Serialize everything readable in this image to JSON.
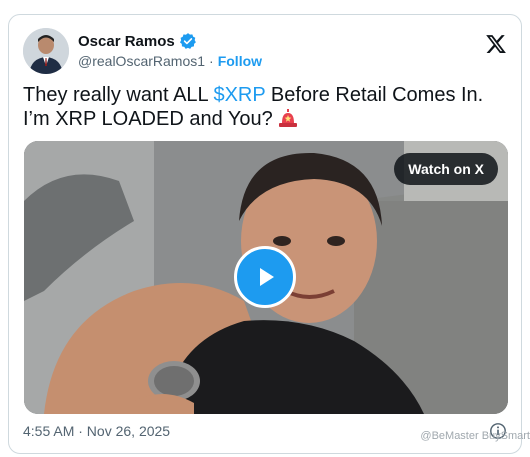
{
  "author": {
    "display_name": "Oscar Ramos",
    "handle": "@realOscarRamos1",
    "separator": "·",
    "follow_label": "Follow",
    "verified_icon": "verified-badge-icon",
    "avatar_icon": "avatar"
  },
  "platform": {
    "logo_icon": "x-logo-icon"
  },
  "tweet": {
    "text_before": "They really want ALL ",
    "cashtag": "$XRP",
    "text_after": " Before Retail Comes In. I’m XRP LOADED and You? ",
    "emoji_icon": "rotating-light-icon"
  },
  "media": {
    "watch_label": "Watch on X",
    "play_icon": "play-icon"
  },
  "footer": {
    "timestamp": "4:55 AM · Nov 26, 2025",
    "info_icon": "info-icon"
  },
  "watermark": "@BeMaster BuySmart",
  "colors": {
    "accent": "#1d9bf0",
    "text": "#0f1419",
    "muted": "#536471",
    "border": "#cfd9de"
  }
}
